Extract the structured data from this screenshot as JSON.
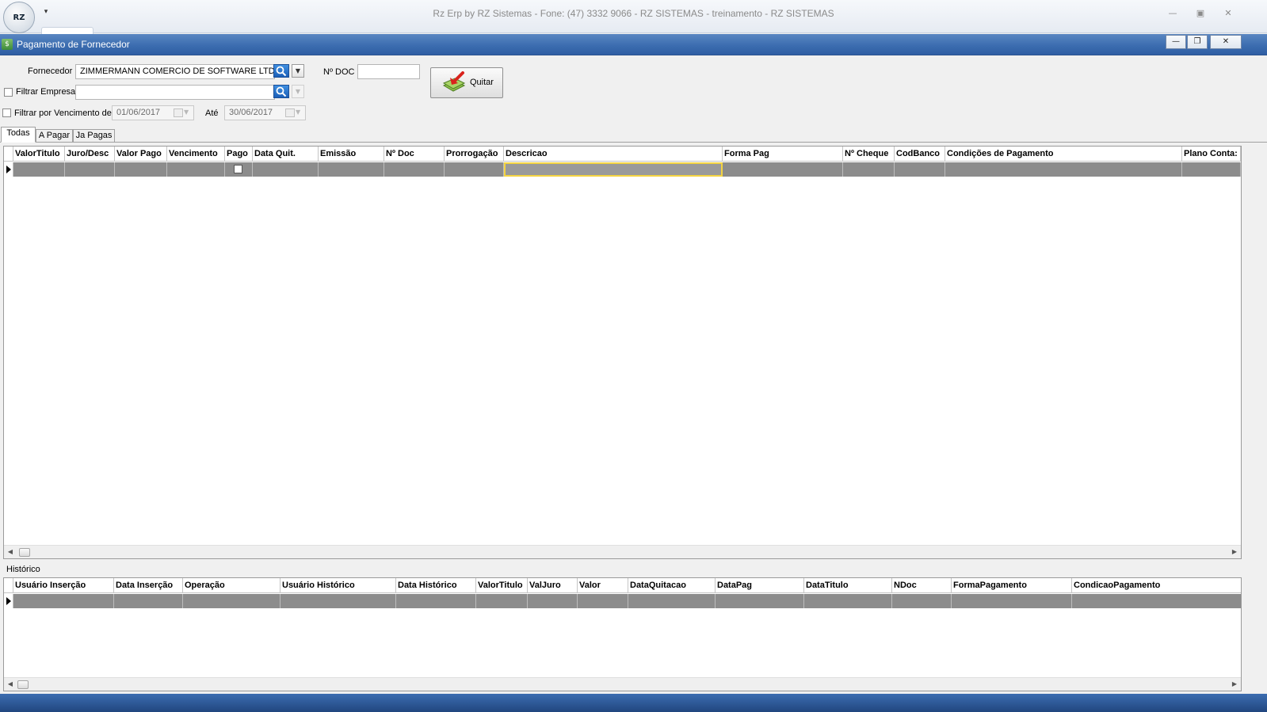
{
  "app": {
    "title": "Rz Erp by RZ Sistemas - Fone: (47) 3332 9066 - RZ SISTEMAS - treinamento - RZ SISTEMAS",
    "logo_text": "RZ"
  },
  "window": {
    "title": "Pagamento de Fornecedor"
  },
  "form": {
    "fornecedor_label": "Fornecedor",
    "fornecedor_value": "ZIMMERMANN COMERCIO DE SOFTWARE LTDA",
    "ndoc_label": "Nº DOC",
    "ndoc_value": "",
    "filtrar_empresa_label": "Filtrar Empresa",
    "empresa_value": "",
    "filtrar_vencimento_label": "Filtrar por Vencimento de",
    "date_from": "01/06/2017",
    "ate_label": "Até",
    "date_to": "30/06/2017",
    "quitar_label": "Quitar"
  },
  "tabs": [
    {
      "label": "Todas",
      "active": true
    },
    {
      "label": "A Pagar",
      "active": false
    },
    {
      "label": "Ja Pagas",
      "active": false
    }
  ],
  "main_grid": {
    "columns": [
      "ValorTitulo",
      "Juro/Desc",
      "Valor Pago",
      "Vencimento",
      "Pago",
      "Data Quit.",
      "Emissão",
      "Nº Doc",
      "Prorrogação",
      "Descricao",
      "Forma Pag",
      "Nº Cheque",
      "CodBanco",
      "Condições de Pagamento",
      "Plano Conta:"
    ]
  },
  "history": {
    "label": "Histórico",
    "columns": [
      "Usuário Inserção",
      "Data Inserção",
      "Operação",
      "Usuário Histórico",
      "Data Histórico",
      "ValorTitulo",
      "ValJuro",
      "Valor",
      "DataQuitacao",
      "DataPag",
      "DataTitulo",
      "NDoc",
      "FormaPagamento",
      "CondicaoPagamento"
    ]
  },
  "colors": {
    "window_title_bg": "#3c6db0",
    "row_selected_bg": "#8c8c8c",
    "focus_outline": "#f4d442",
    "search_button": "#1b5fb8",
    "quitar_arrow": "#d9231d"
  }
}
